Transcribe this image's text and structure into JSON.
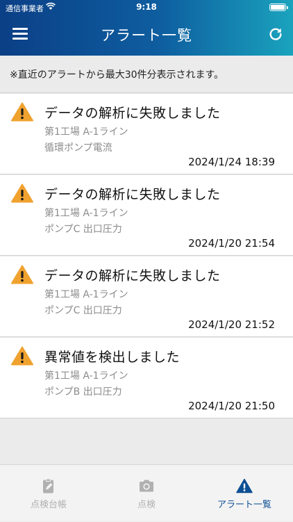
{
  "status_bar": {
    "carrier": "通信事業者",
    "time": "9:18"
  },
  "header": {
    "title": "アラート一覧"
  },
  "notice": "※直近のアラートから最大30件分表示されます。",
  "alerts": [
    {
      "title": "データの解析に失敗しました",
      "location": "第1工場 A-1ライン",
      "detail": "循環ポンプ電流",
      "time": "2024/1/24 18:39"
    },
    {
      "title": "データの解析に失敗しました",
      "location": "第1工場 A-1ライン",
      "detail": "ポンプC 出口圧力",
      "time": "2024/1/20 21:54"
    },
    {
      "title": "データの解析に失敗しました",
      "location": "第1工場 A-1ライン",
      "detail": "ポンプC 出口圧力",
      "time": "2024/1/20 21:52"
    },
    {
      "title": "異常値を検出しました",
      "location": "第1工場 A-1ライン",
      "detail": "ポンプB 出口圧力",
      "time": "2024/1/20 21:50"
    }
  ],
  "tabs": [
    {
      "label": "点検台帳",
      "icon": "clipboard-edit-icon",
      "active": false
    },
    {
      "label": "点検",
      "icon": "camera-icon",
      "active": false
    },
    {
      "label": "アラート一覧",
      "icon": "warning-icon",
      "active": true
    }
  ],
  "colors": {
    "warning": "#f0a22e",
    "accent": "#0d4f94",
    "inactive": "#b0b0b0"
  }
}
